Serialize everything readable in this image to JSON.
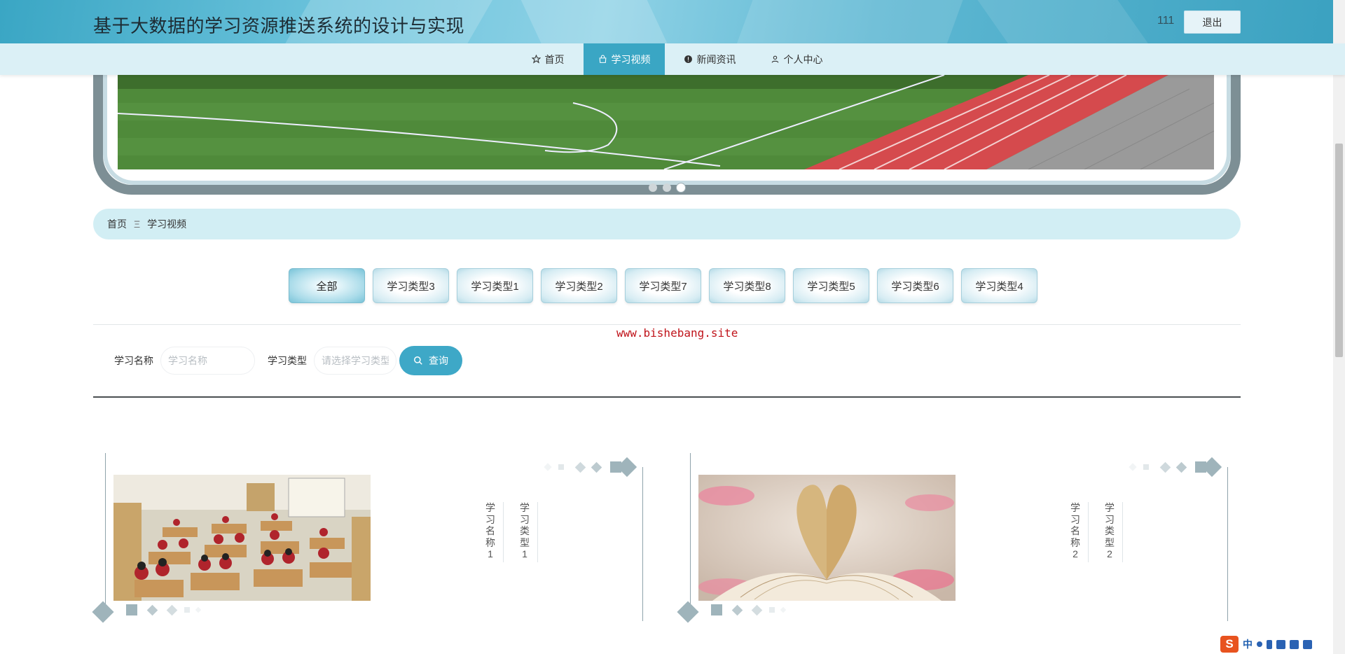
{
  "header": {
    "title": "基于大数据的学习资源推送系统的设计与实现",
    "username": "111",
    "logout_label": "退出"
  },
  "nav": {
    "items": [
      {
        "label": "首页",
        "icon": "star-icon"
      },
      {
        "label": "学习视频",
        "icon": "bag-icon"
      },
      {
        "label": "新闻资讯",
        "icon": "info-icon"
      },
      {
        "label": "个人中心",
        "icon": "user-icon"
      }
    ],
    "active": "学习视频"
  },
  "carousel": {
    "slides": 3,
    "active_slide": 3
  },
  "breadcrumb": {
    "home": "首页",
    "separator": "Ξ",
    "current": "学习视频"
  },
  "categories": [
    "全部",
    "学习类型3",
    "学习类型1",
    "学习类型2",
    "学习类型7",
    "学习类型8",
    "学习类型5",
    "学习类型6",
    "学习类型4"
  ],
  "active_category": "全部",
  "watermark": "www.bishebang.site",
  "search": {
    "name_label": "学习名称",
    "name_placeholder": "学习名称",
    "type_label": "学习类型",
    "type_placeholder": "请选择学习类型",
    "query_label": "查询"
  },
  "cards": [
    {
      "name": "学习名称1",
      "type": "学习类型1"
    },
    {
      "name": "学习名称2",
      "type": "学习类型2"
    }
  ],
  "ime": {
    "label": "中"
  },
  "colors": {
    "accent": "#3aa6c4",
    "nav_bg": "#dbf0f6",
    "frame": "#7d8f95",
    "watermark": "#c0141b"
  }
}
